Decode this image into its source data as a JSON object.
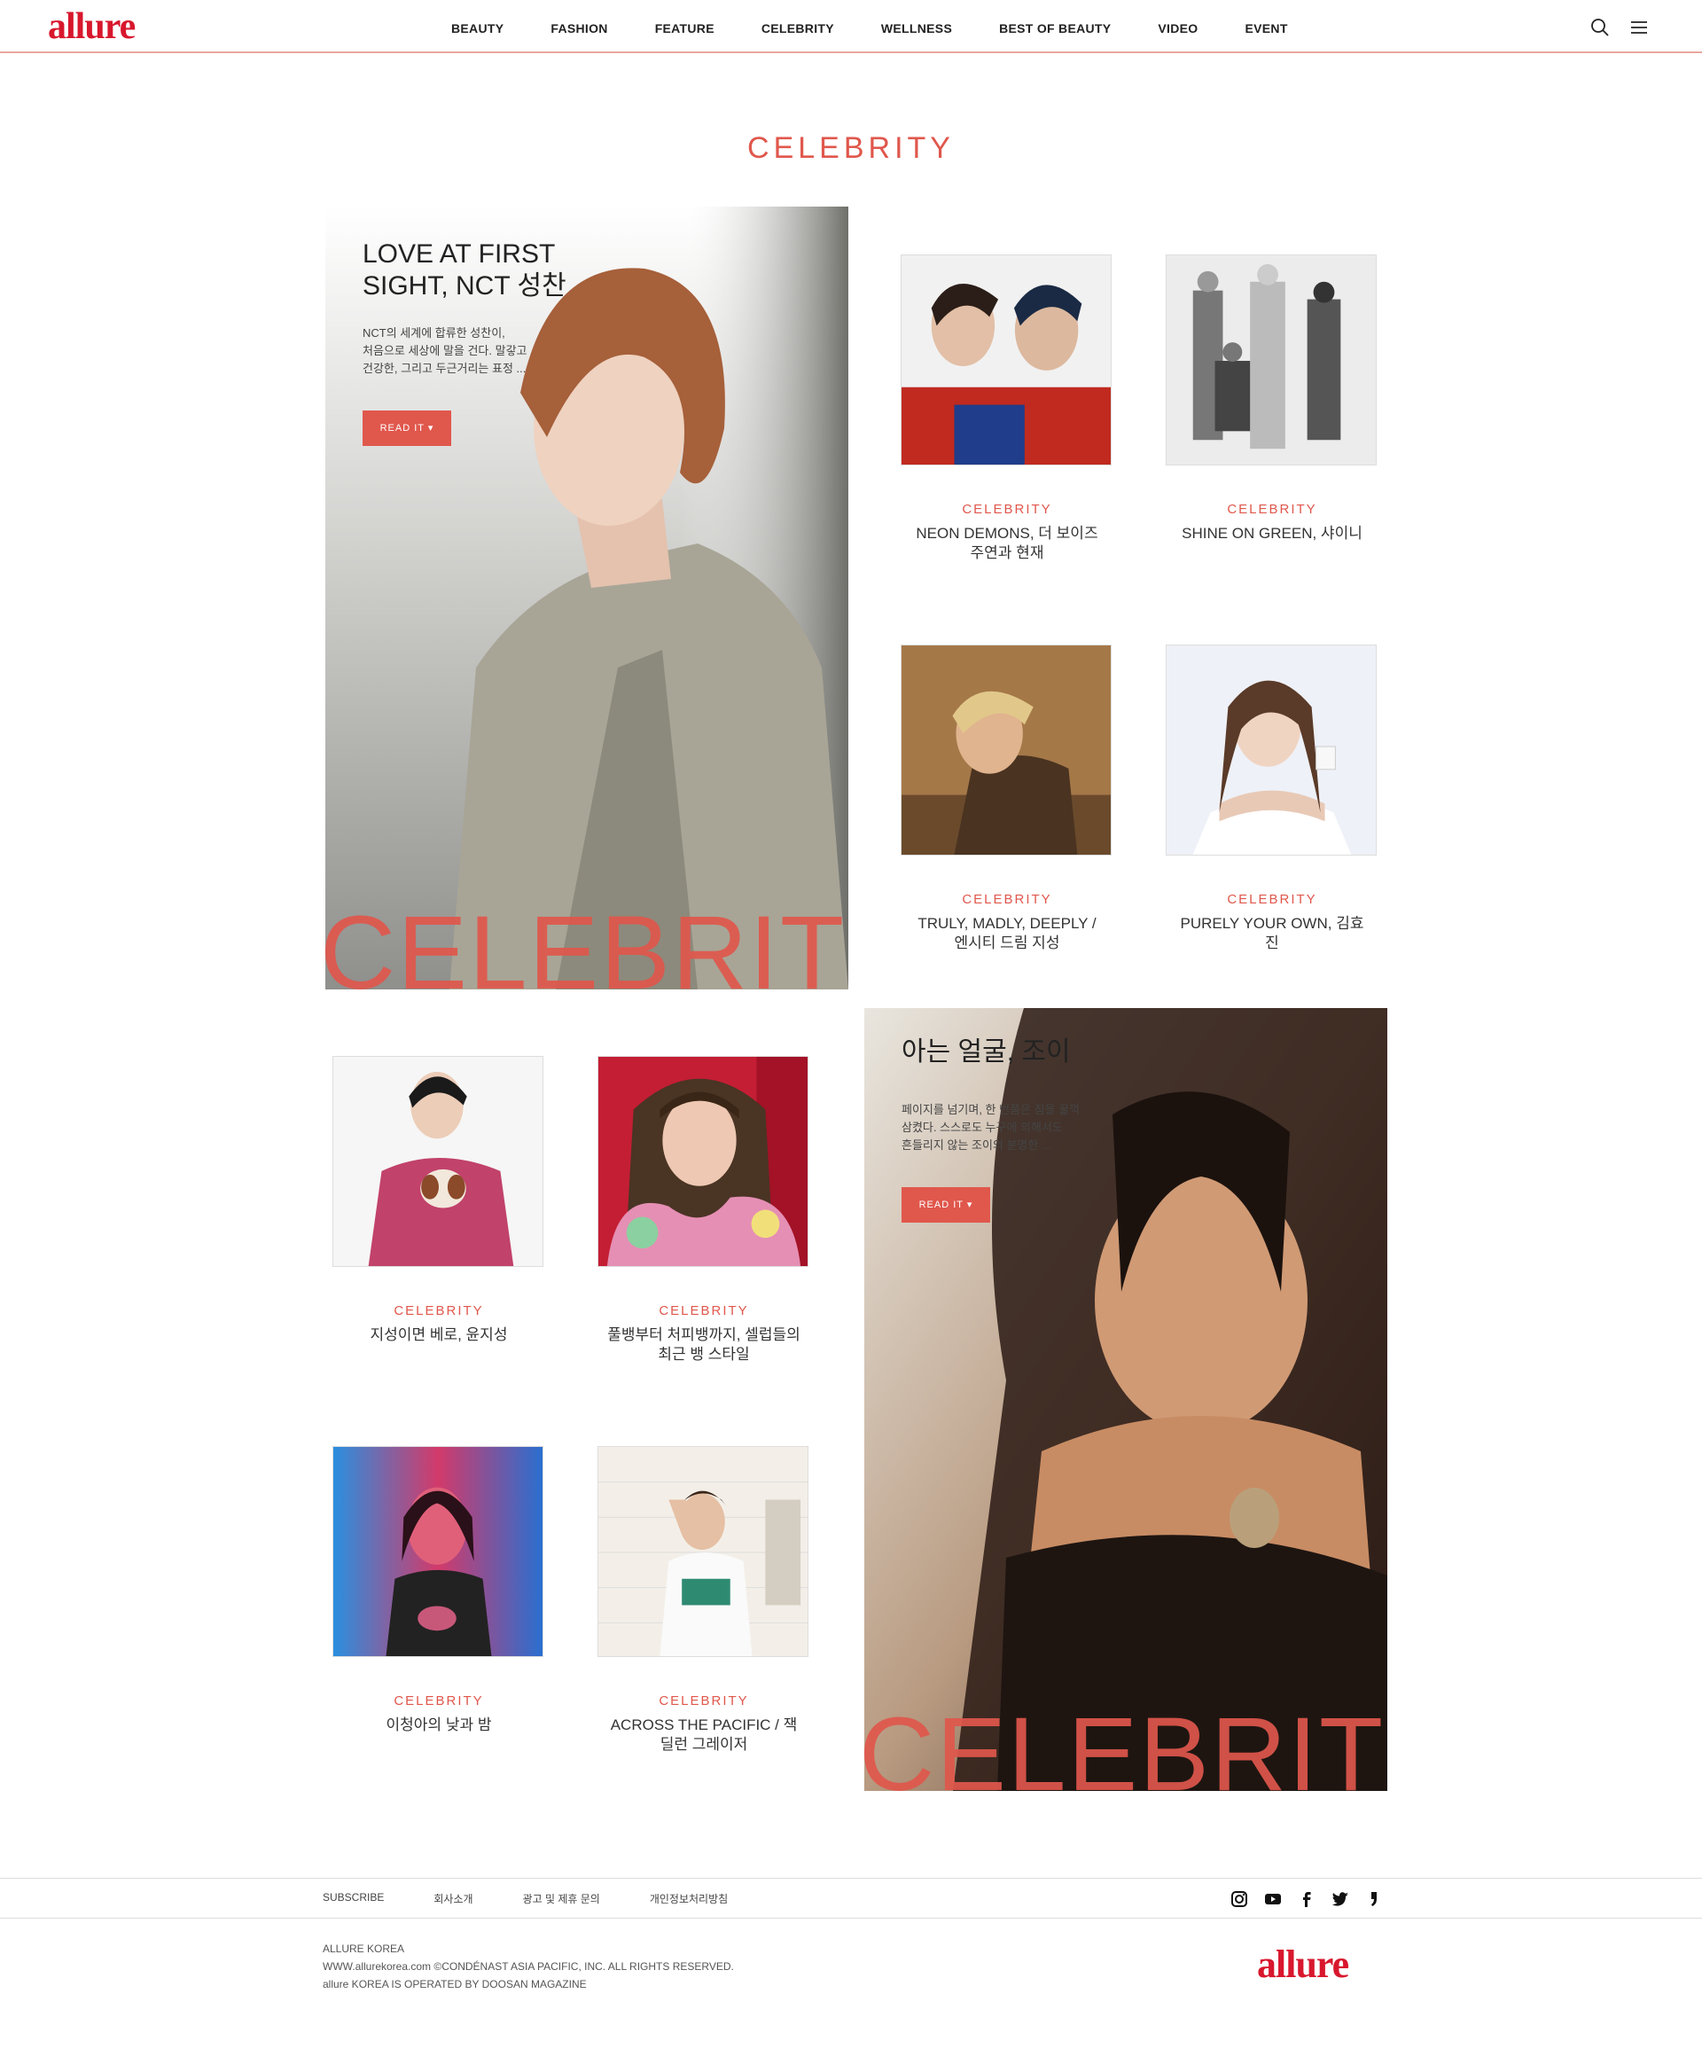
{
  "header": {
    "logo": "allure",
    "nav": [
      "BEAUTY",
      "FASHION",
      "FEATURE",
      "CELEBRITY",
      "WELLNESS",
      "BEST OF BEAUTY",
      "VIDEO",
      "EVENT"
    ]
  },
  "page": {
    "title": "CELEBRITY"
  },
  "feature1": {
    "title_line1": "LOVE AT FIRST",
    "title_line2": "SIGHT, NCT 성찬",
    "desc_line1": "NCT의 세계에 합류한 성찬이,",
    "desc_line2": "처음으로 세상에 말을 건다. 말갛고",
    "desc_line3": "건강한, 그리고 두근거리는 표정 ...",
    "button": "READ IT ▾",
    "big_word": "CELEBRITY"
  },
  "feature2": {
    "title": "아는 얼굴, 조이",
    "desc_line1": "페이지를 넘기며, 한 번쯤은 침을 꿀꺽",
    "desc_line2": "삼켰다. 스스로도 누구에 의해서도",
    "desc_line3": "흔들리지 않는 조이의 분명한 ...",
    "button": "READ IT ▾",
    "big_word": "CELEBRITY"
  },
  "cards": [
    {
      "category": "CELEBRITY",
      "title": "NEON DEMONS, 더 보이즈 주연과 현재"
    },
    {
      "category": "CELEBRITY",
      "title": "SHINE ON GREEN, 샤이니"
    },
    {
      "category": "CELEBRITY",
      "title": "TRULY, MADLY, DEEPLY / 엔시티 드림 지성"
    },
    {
      "category": "CELEBRITY",
      "title": "PURELY YOUR OWN, 김효진"
    },
    {
      "category": "CELEBRITY",
      "title": "지성이면 베로, 윤지성"
    },
    {
      "category": "CELEBRITY",
      "title": "풀뱅부터 처피뱅까지, 셀럽들의 최근 뱅 스타일"
    },
    {
      "category": "CELEBRITY",
      "title": "이청아의 낮과 밤"
    },
    {
      "category": "CELEBRITY",
      "title": "ACROSS THE PACIFIC / 잭 딜런 그레이저"
    }
  ],
  "footer": {
    "links": [
      "SUBSCRIBE",
      "회사소개",
      "광고 및 제휴 문의",
      "개인정보처리방침"
    ],
    "social": [
      "instagram-icon",
      "youtube-icon",
      "facebook-icon",
      "twitter-icon",
      "post-icon"
    ],
    "info_line1": "ALLURE KOREA",
    "info_line2": "WWW.allurekorea.com ©CONDÉNAST ASIA PACIFIC, INC. ALL RIGHTS RESERVED.",
    "info_line3": "allure KOREA IS OPERATED BY DOOSAN MAGAZINE",
    "logo": "allure"
  },
  "colors": {
    "accent": "#e0574c",
    "brand": "#d8172d"
  }
}
